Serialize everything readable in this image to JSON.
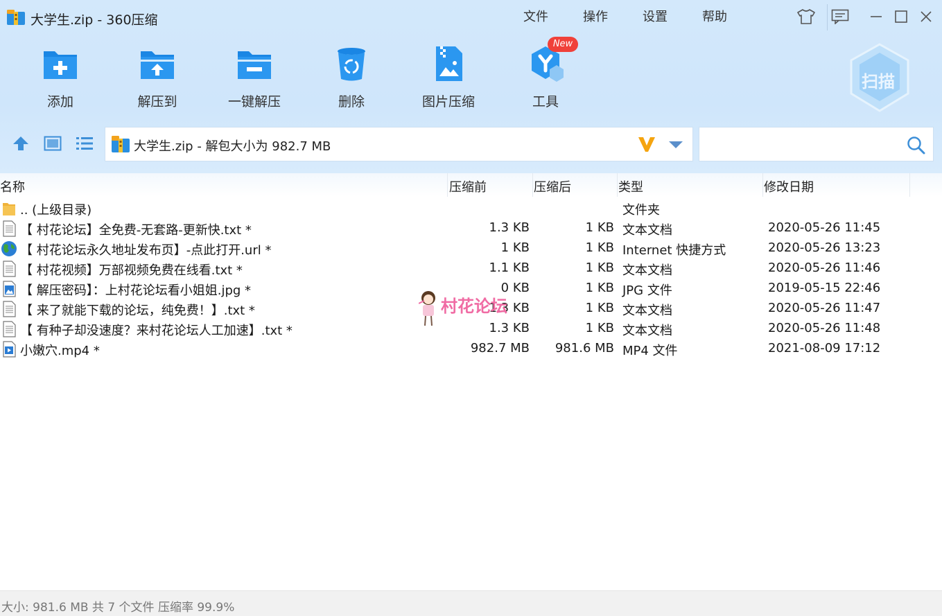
{
  "window": {
    "title": "大学生.zip - 360压缩",
    "menus": [
      "文件",
      "操作",
      "设置",
      "帮助"
    ]
  },
  "toolbar": {
    "items": [
      {
        "label": "添加",
        "icon": "add-icon"
      },
      {
        "label": "解压到",
        "icon": "extract-to-icon"
      },
      {
        "label": "一键解压",
        "icon": "one-click-extract-icon"
      },
      {
        "label": "删除",
        "icon": "delete-icon"
      },
      {
        "label": "图片压缩",
        "icon": "image-compress-icon"
      },
      {
        "label": "工具",
        "icon": "tools-icon"
      }
    ],
    "new_badge": "New",
    "scan_label": "扫描"
  },
  "address": {
    "text": "大学生.zip - 解包大小为 982.7 MB"
  },
  "search": {
    "placeholder": ""
  },
  "columns": {
    "name": "名称",
    "before": "压缩前",
    "after": "压缩后",
    "type": "类型",
    "date": "修改日期"
  },
  "files": [
    {
      "name": ".. (上级目录)",
      "before": "",
      "after": "",
      "type": "文件夹",
      "date": "",
      "icon": "folder-icon"
    },
    {
      "name": "【 村花论坛】全免费-无套路-更新快.txt *",
      "before": "1.3 KB",
      "after": "1 KB",
      "type": "文本文档",
      "date": "2020-05-26 11:45",
      "icon": "text-file-icon"
    },
    {
      "name": "【 村花论坛永久地址发布页】-点此打开.url *",
      "before": "1 KB",
      "after": "1 KB",
      "type": "Internet 快捷方式",
      "date": "2020-05-26 13:23",
      "icon": "globe-icon"
    },
    {
      "name": "【 村花视频】万部视频免费在线看.txt *",
      "before": "1.1 KB",
      "after": "1 KB",
      "type": "文本文档",
      "date": "2020-05-26 11:46",
      "icon": "text-file-icon"
    },
    {
      "name": "【 解压密码】：上村花论坛看小姐姐.jpg *",
      "before": "0 KB",
      "after": "1 KB",
      "type": "JPG 文件",
      "date": "2019-05-15 22:46",
      "icon": "image-file-icon"
    },
    {
      "name": "【 来了就能下载的论坛，纯免费！】.txt *",
      "before": "1.3 KB",
      "after": "1 KB",
      "type": "文本文档",
      "date": "2020-05-26 11:47",
      "icon": "text-file-icon"
    },
    {
      "name": "【 有种子却没速度？来村花论坛人工加速】.txt *",
      "before": "1.3 KB",
      "after": "1 KB",
      "type": "文本文档",
      "date": "2020-05-26 11:48",
      "icon": "text-file-icon"
    },
    {
      "name": "小嫩穴.mp4 *",
      "before": "982.7 MB",
      "after": "981.6 MB",
      "type": "MP4 文件",
      "date": "2021-08-09 17:12",
      "icon": "video-file-icon"
    }
  ],
  "watermark": "村花论坛",
  "status": "大小: 981.6 MB 共 7 个文件 压缩率 99.9%",
  "colors": {
    "header_bg": "#d3e8fb",
    "accent": "#1e8be6",
    "badge": "#f0413a",
    "watermark": "#f06ca4"
  }
}
